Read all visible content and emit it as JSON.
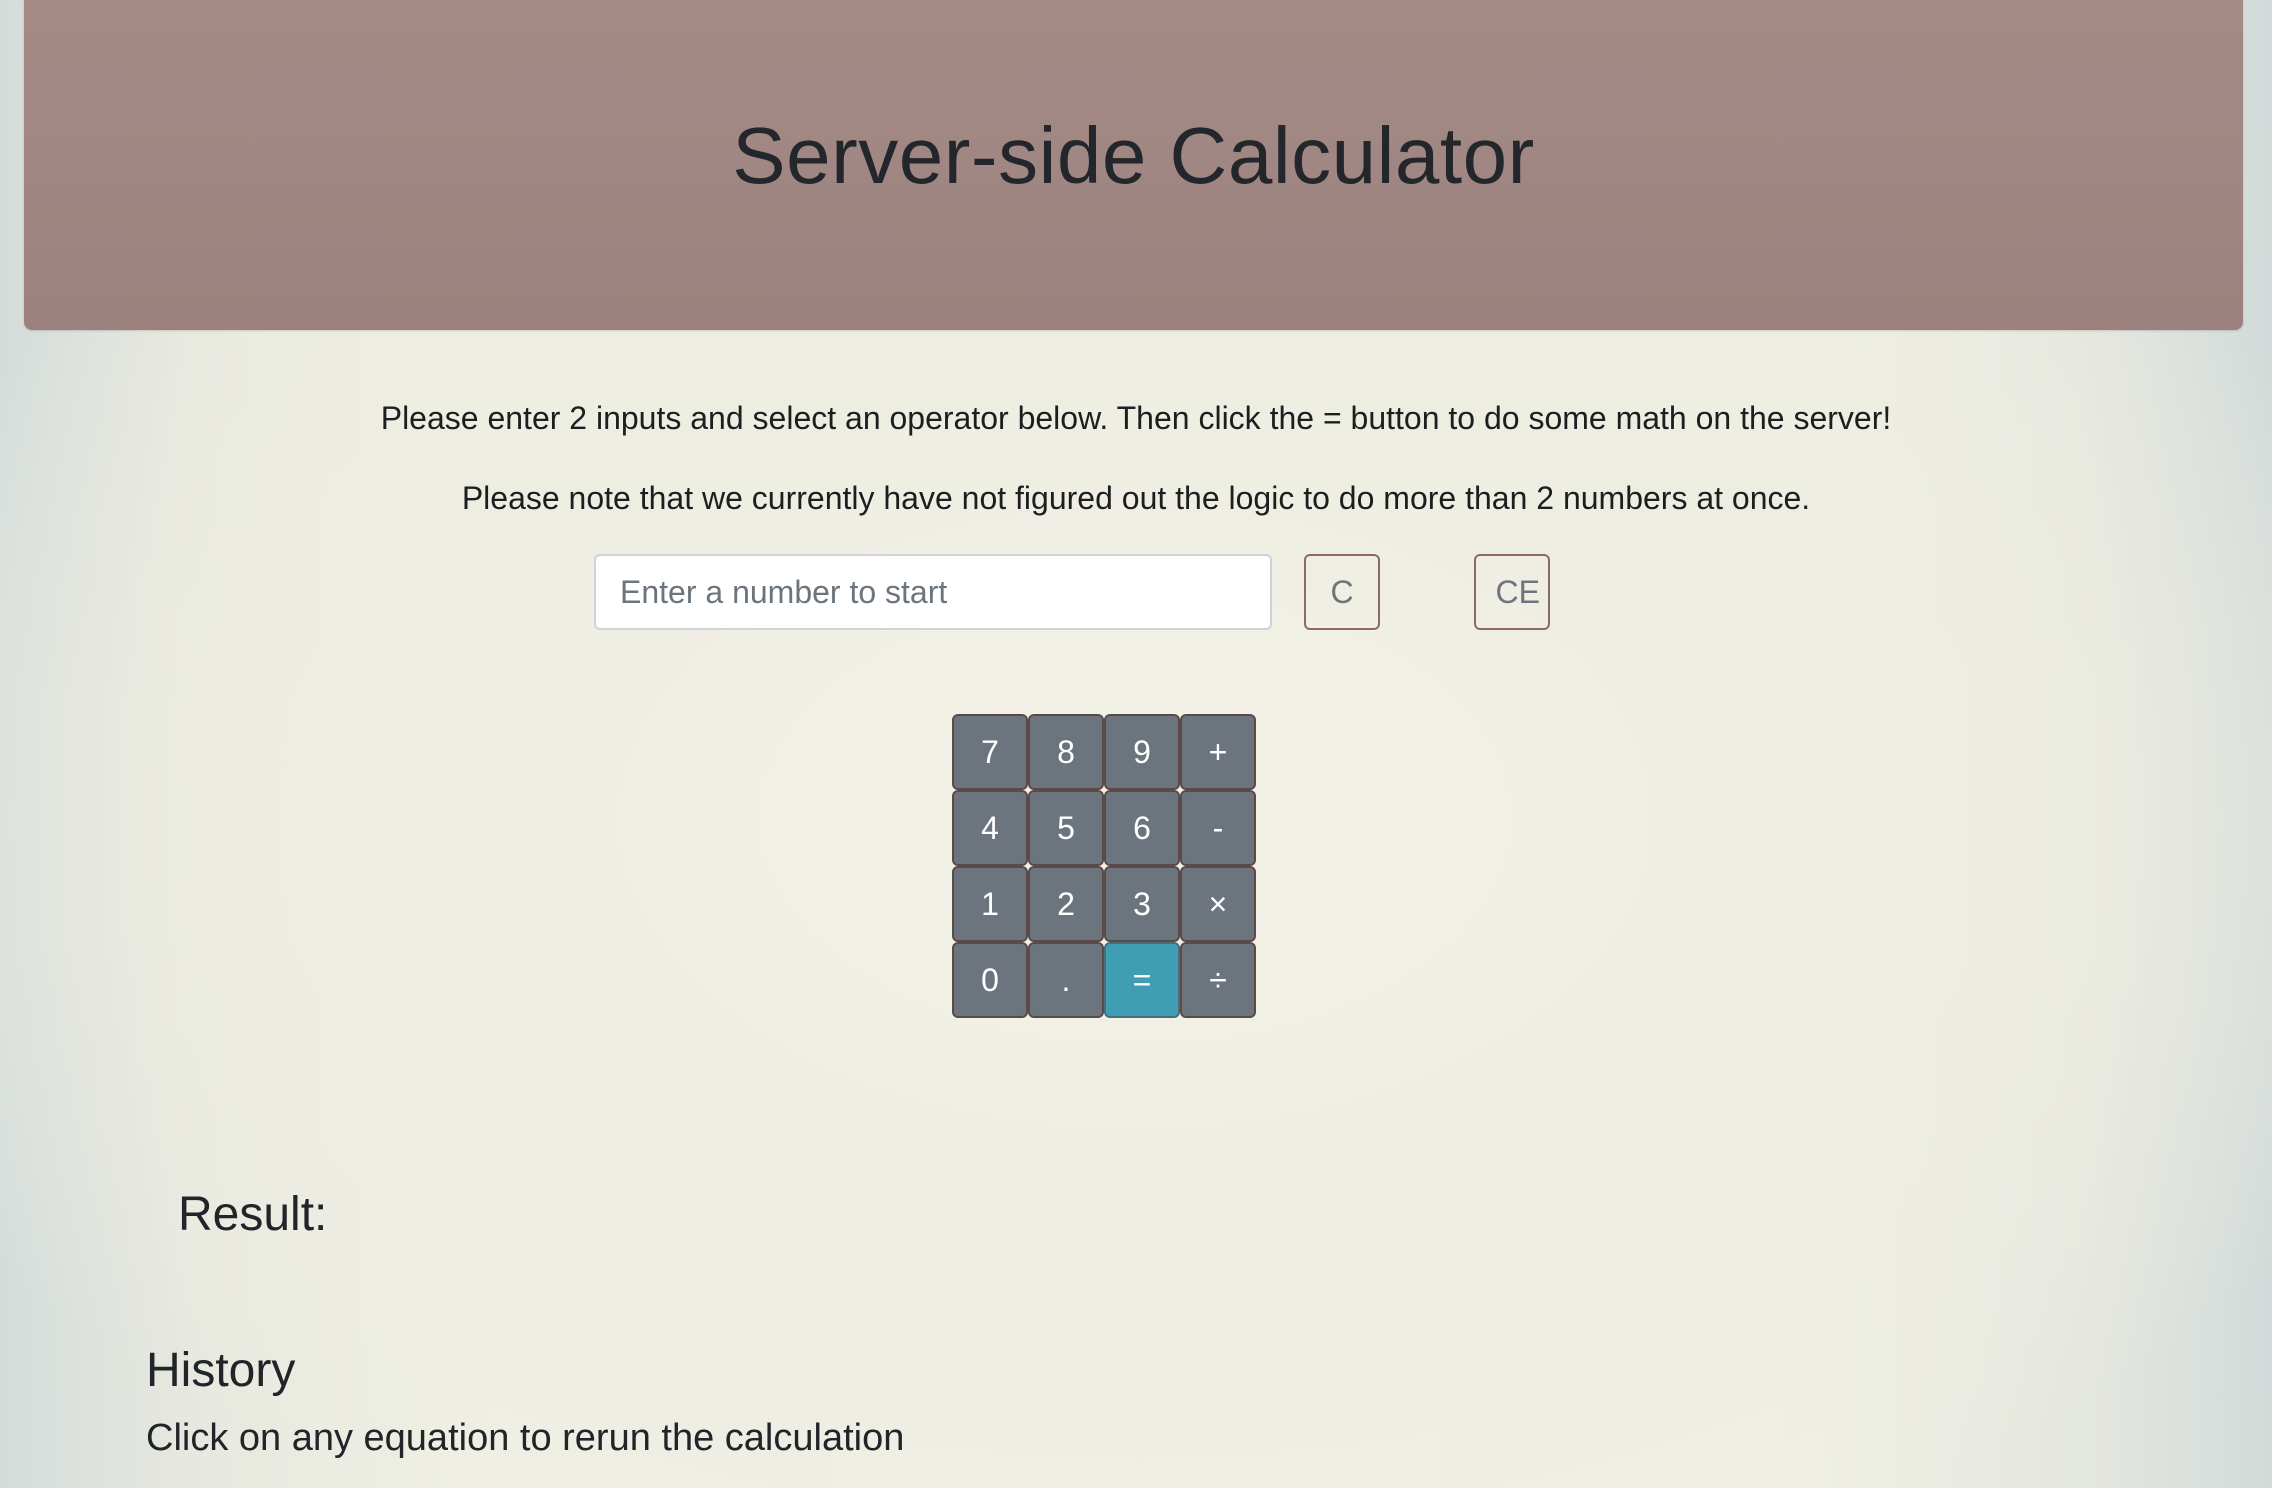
{
  "header": {
    "title": "Server-side Calculator"
  },
  "instructions": {
    "line1": "Please enter 2 inputs and select an operator below. Then click the = button to do some math on the server!",
    "line2": "Please note that we currently have not figured out the logic to do more than 2 numbers at once."
  },
  "input": {
    "value": "",
    "placeholder": "Enter a number to start"
  },
  "controls": {
    "clear_label": "C",
    "clear_entry_label": "CE"
  },
  "keypad": {
    "keys": [
      "7",
      "8",
      "9",
      "+",
      "4",
      "5",
      "6",
      "-",
      "1",
      "2",
      "3",
      "×",
      "0",
      ".",
      "=",
      "÷"
    ]
  },
  "result": {
    "label": "Result:"
  },
  "history": {
    "title": "History",
    "subtitle": "Click on any equation to rerun the calculation"
  },
  "colors": {
    "header_bg": "#a18783",
    "key_bg": "#6c757d",
    "equals_bg": "#3f9eb4",
    "clear_border": "#8d6a6a"
  }
}
